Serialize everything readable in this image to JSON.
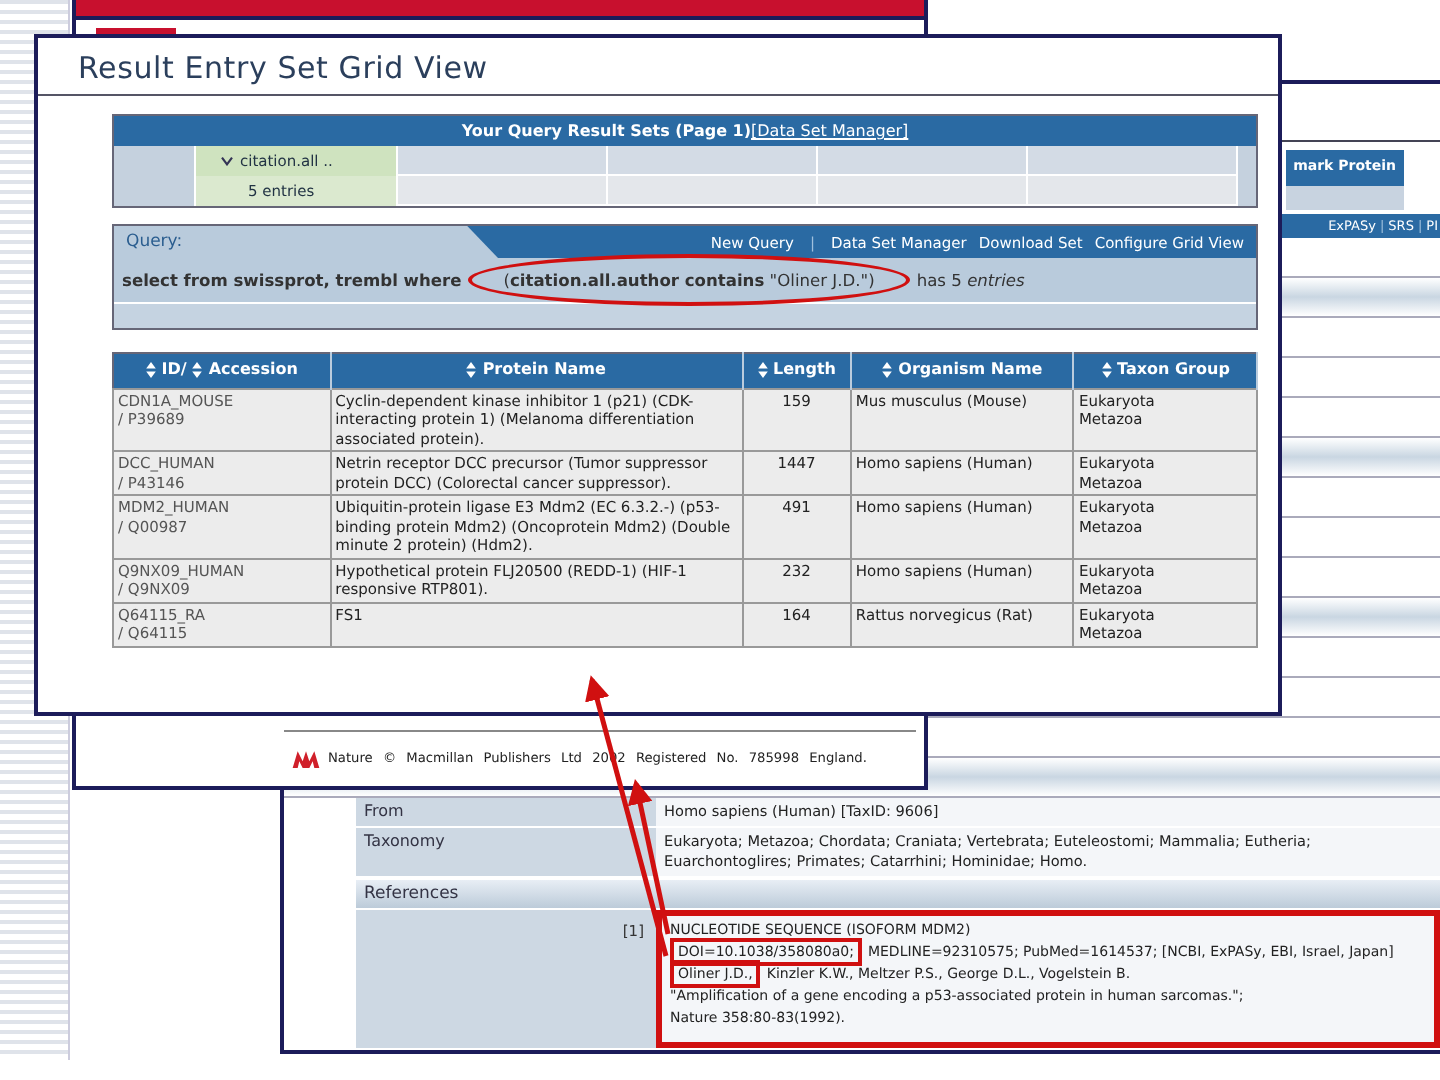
{
  "back_page": {
    "footer": "Nature © Macmillan Publishers Ltd 2002 Registered No. 785998 England."
  },
  "entry_window": {
    "partial_button": "mark Protein",
    "links": [
      {
        "kind": "link",
        "text": "ExPASy"
      },
      {
        "kind": "separator",
        "text": "|"
      },
      {
        "kind": "link",
        "text": "SRS"
      },
      {
        "kind": "separator",
        "text": "|"
      },
      {
        "kind": "link",
        "text": "PI"
      }
    ],
    "fields": [
      {
        "label": "From",
        "value": "Homo sapiens (Human) [TaxID: 9606]"
      },
      {
        "label": "Taxonomy",
        "value": "Eukaryota; Metazoa; Chordata; Craniata; Vertebrata; Euteleostomi; Mammalia; Eutheria; Euarchontoglires; Primates; Catarrhini; Hominidae; Homo."
      }
    ],
    "references": {
      "heading": "References",
      "items": [
        {
          "number": "[1]",
          "lines": [
            [
              {
                "text": "NUCLEOTIDE SEQUENCE (ISOFORM MDM2)",
                "marked": false
              }
            ],
            [
              {
                "text": "DOI=10.1038/358080a0;",
                "marked": true
              },
              {
                "text": "MEDLINE=92310575; PubMed=1614537; [NCBI, ExPASy, EBI, Israel, Japan]",
                "marked": false
              }
            ],
            [
              {
                "text": "Oliner J.D.,",
                "marked": true
              },
              {
                "text": "Kinzler K.W., Meltzer P.S., George D.L., Vogelstein B.",
                "marked": false
              }
            ],
            [
              {
                "text": "\"Amplification of a gene encoding a p53-associated protein in human sarcomas.\";",
                "marked": false
              }
            ],
            [
              {
                "text": "Nature 358:80-83(1992).",
                "marked": false
              }
            ]
          ]
        }
      ]
    }
  },
  "grid_window": {
    "title": "Result Entry Set Grid View",
    "result_sets": {
      "heading": "Your Query Result Sets (Page 1)",
      "manager_link": "[Data Set Manager]",
      "set_name": "citation.all ..",
      "set_count": "5 entries"
    },
    "query": {
      "label": "Query:",
      "links": [
        {
          "kind": "link",
          "text": "New Query"
        },
        {
          "kind": "separator",
          "text": "|"
        },
        {
          "kind": "link",
          "text": "Data Set Manager"
        },
        {
          "kind": "link",
          "text": "Download Set"
        },
        {
          "kind": "link",
          "text": "Configure Grid View"
        }
      ],
      "prefix": "**select from swissprot, trembl where**",
      "condition": "(**citation.all.author contains** \"Oliner J.D.\")",
      "condition_circled": true,
      "suffix": "has 5 *entries*"
    },
    "table": {
      "columns": [
        {
          "labels": [
            "ID/",
            "Accession"
          ]
        },
        {
          "labels": [
            "Protein Name"
          ]
        },
        {
          "labels": [
            "Length"
          ]
        },
        {
          "labels": [
            "Organism Name"
          ]
        },
        {
          "labels": [
            "Taxon Group"
          ]
        }
      ],
      "rows": [
        {
          "id": "CDN1A_MOUSE",
          "accession": "/ P39689",
          "protein": "Cyclin-dependent kinase inhibitor 1 (p21) (CDK-interacting protein 1) (Melanoma differentiation associated protein).",
          "length": "159",
          "organism": "Mus musculus (Mouse)",
          "taxon": [
            "Eukaryota",
            "Metazoa"
          ]
        },
        {
          "id": "DCC_HUMAN",
          "accession": "/ P43146",
          "protein": "Netrin receptor DCC precursor (Tumor suppressor protein DCC) (Colorectal cancer suppressor).",
          "length": "1447",
          "organism": "Homo sapiens (Human)",
          "taxon": [
            "Eukaryota",
            "Metazoa"
          ]
        },
        {
          "id": "MDM2_HUMAN",
          "accession": "/ Q00987",
          "protein": "Ubiquitin-protein ligase E3 Mdm2 (EC 6.3.2.-) (p53-binding protein Mdm2) (Oncoprotein Mdm2) (Double minute 2 protein) (Hdm2).",
          "length": "491",
          "organism": "Homo sapiens (Human)",
          "taxon": [
            "Eukaryota",
            "Metazoa"
          ]
        },
        {
          "id": "Q9NX09_HUMAN",
          "accession": "/ Q9NX09",
          "protein": "Hypothetical protein FLJ20500 (REDD-1) (HIF-1 responsive RTP801).",
          "length": "232",
          "organism": "Homo sapiens (Human)",
          "taxon": [
            "Eukaryota",
            "Metazoa"
          ]
        },
        {
          "id": "Q64115_RA",
          "accession": "/ Q64115",
          "protein": "FS1",
          "length": "164",
          "organism": "Rattus norvegicus (Rat)",
          "taxon": [
            "Eukaryota",
            "Metazoa"
          ]
        }
      ]
    }
  }
}
